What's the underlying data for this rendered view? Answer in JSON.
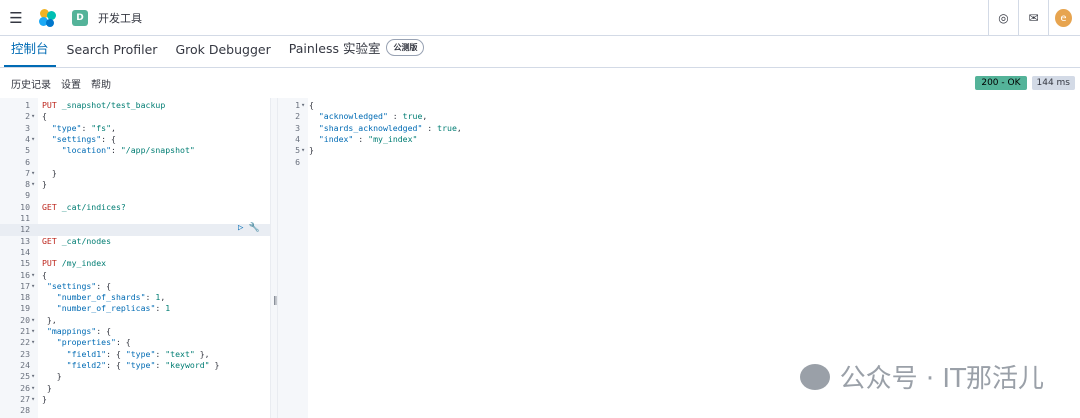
{
  "topbar": {
    "space_initial": "D",
    "breadcrumb": "开发工具",
    "avatar_initial": "e"
  },
  "tabs": [
    {
      "label": "控制台",
      "active": true
    },
    {
      "label": "Search Profiler",
      "active": false
    },
    {
      "label": "Grok Debugger",
      "active": false
    },
    {
      "label": "Painless 实验室",
      "active": false,
      "badge": "公测版"
    }
  ],
  "toolbar": {
    "history": "历史记录",
    "settings": "设置",
    "help": "帮助",
    "status": "200 - OK",
    "time": "144 ms"
  },
  "request_lines": [
    "PUT _snapshot/test_backup",
    "{",
    "  \"type\": \"fs\",",
    "  \"settings\": {",
    "    \"location\": \"/app/snapshot\"",
    "",
    "  }",
    "}",
    "",
    "GET _cat/indices?",
    "",
    "",
    "GET _cat/nodes",
    "",
    "PUT /my_index",
    "{",
    " \"settings\": {",
    "   \"number_of_shards\": 1,",
    "   \"number_of_replicas\": 1",
    " },",
    " \"mappings\": {",
    "   \"properties\": {",
    "     \"field1\": { \"type\": \"text\" },",
    "     \"field2\": { \"type\": \"keyword\" }",
    "   }",
    " }",
    "}",
    ""
  ],
  "response_lines": [
    "{",
    "  \"acknowledged\" : true,",
    "  \"shards_acknowledged\" : true,",
    "  \"index\" : \"my_index\"",
    "}",
    ""
  ],
  "watermark": "公众号 · IT那活儿"
}
